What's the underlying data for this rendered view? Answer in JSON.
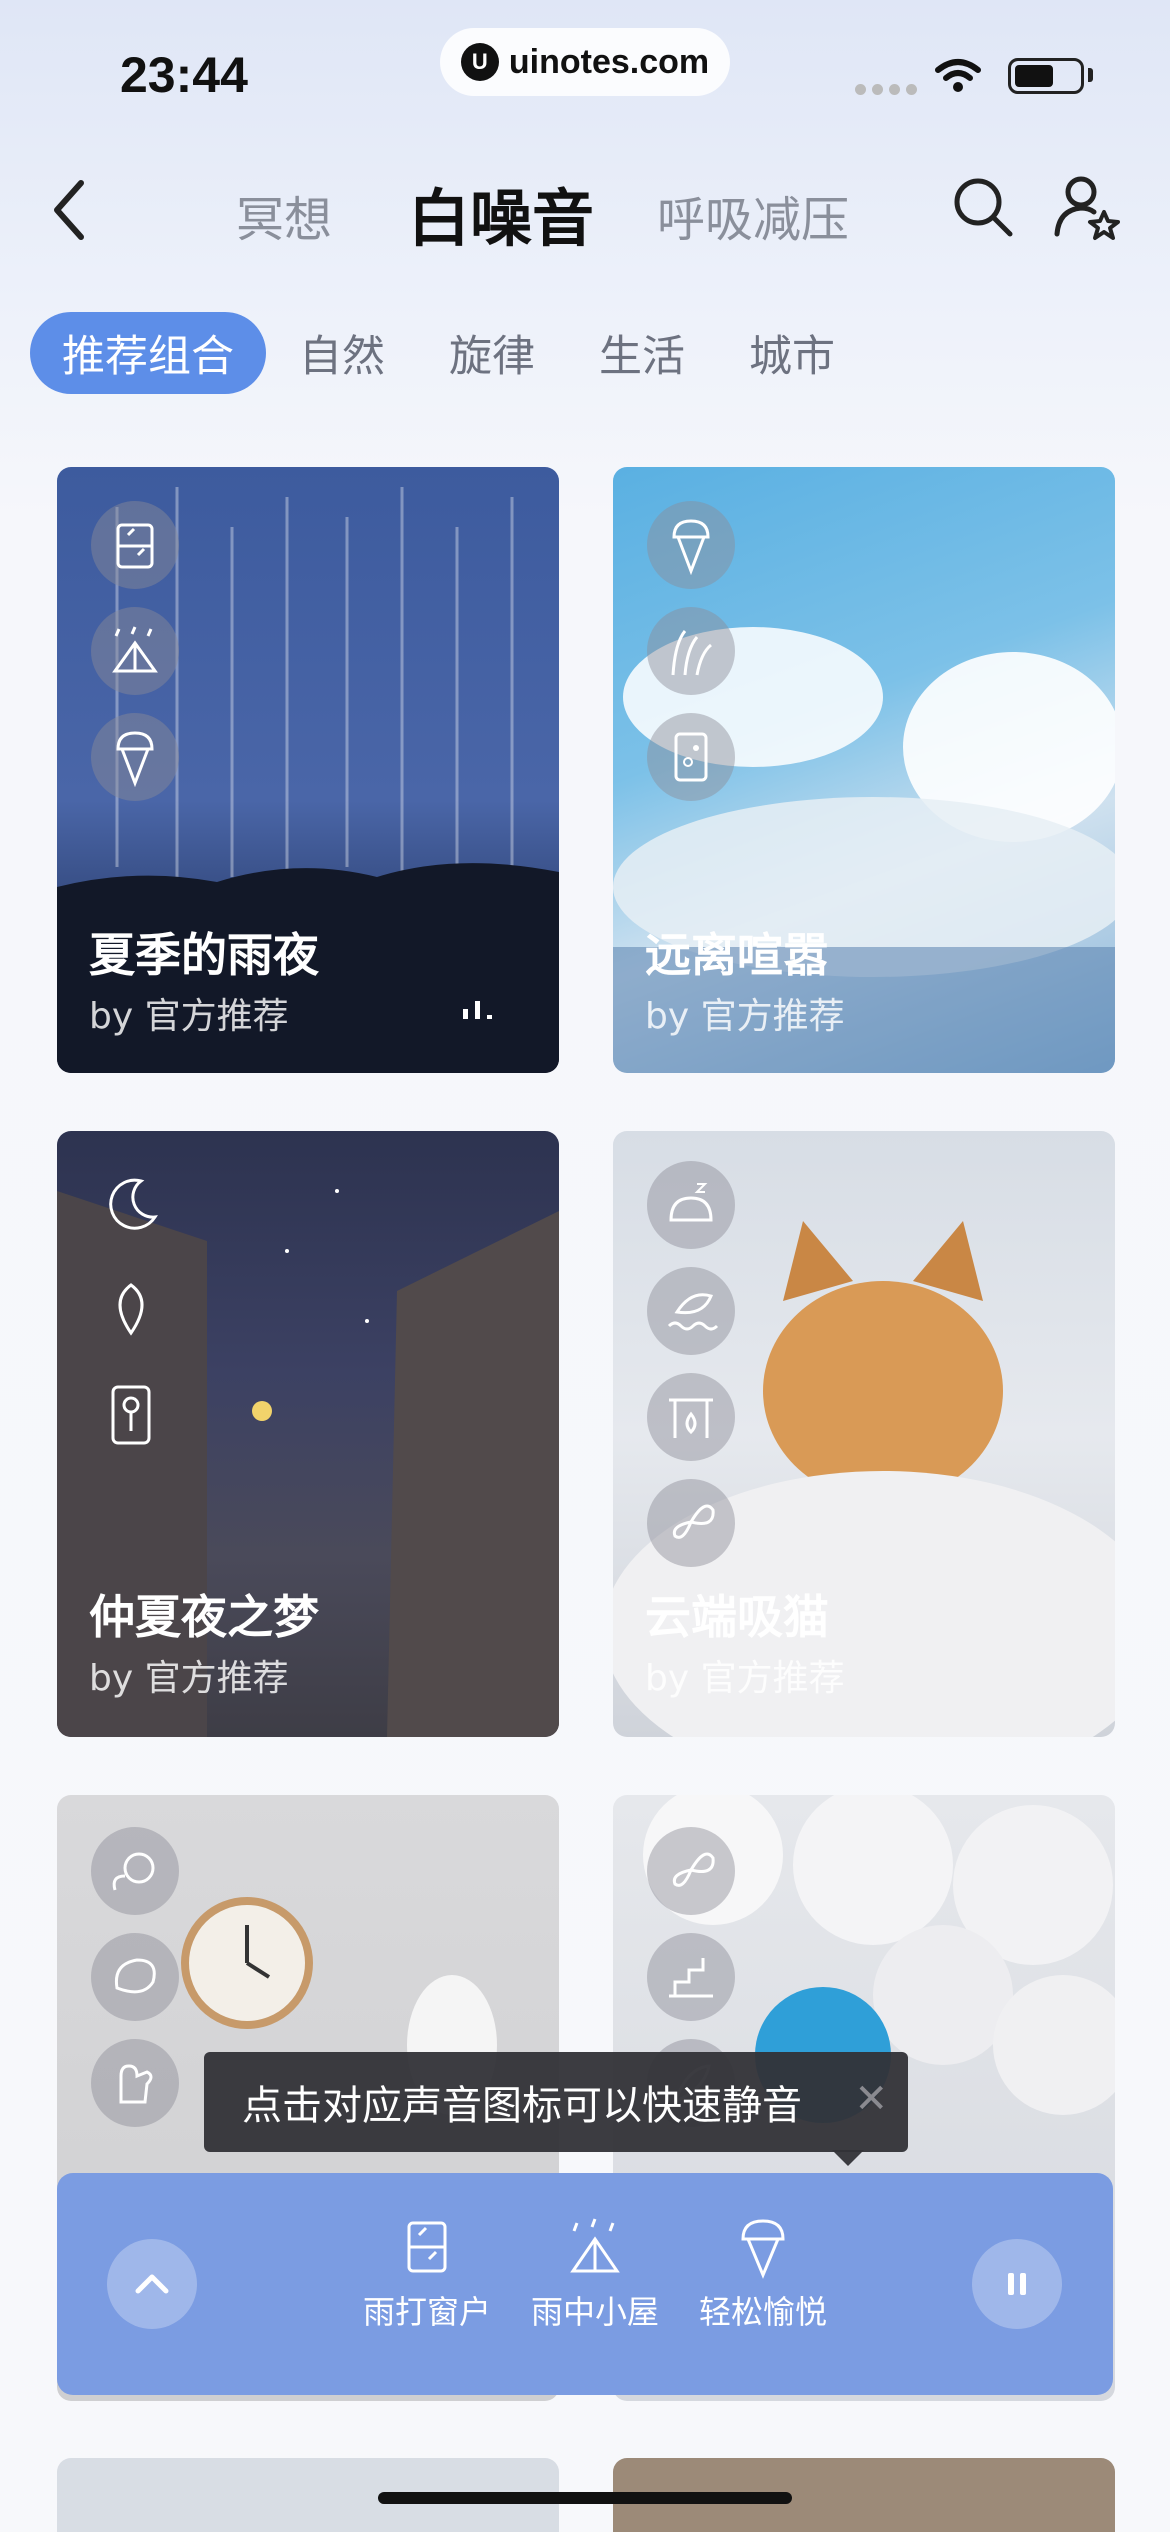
{
  "status": {
    "time": "23:44",
    "url": "uinotes.com",
    "url_logo": "U"
  },
  "header": {
    "tabs": [
      {
        "label": "冥想",
        "active": false
      },
      {
        "label": "白噪音",
        "active": true
      },
      {
        "label": "呼吸减压",
        "active": false
      }
    ],
    "icons": [
      "back-icon",
      "search-icon",
      "user-favorite-icon"
    ]
  },
  "categories": [
    {
      "label": "推荐组合",
      "active": true
    },
    {
      "label": "自然",
      "active": false
    },
    {
      "label": "旋律",
      "active": false
    },
    {
      "label": "生活",
      "active": false
    },
    {
      "label": "城市",
      "active": false
    }
  ],
  "cards": [
    {
      "title": "夏季的雨夜",
      "by": "by 官方推荐",
      "icons": [
        "window-rain-icon",
        "rain-tent-icon",
        "ice-cream-icon"
      ],
      "playing": true
    },
    {
      "title": "远离喧嚣",
      "by": "by 官方推荐",
      "icons": [
        "ice-cream-icon",
        "grass-icon",
        "scroll-icon"
      ]
    },
    {
      "title": "仲夏夜之梦",
      "by": "by 官方推荐",
      "icons": [
        "moon-icon",
        "leaf-moon-icon",
        "clock-pendulum-icon"
      ]
    },
    {
      "title": "云端吸猫",
      "by": "by 官方推荐",
      "icons": [
        "sleeping-cat-icon",
        "wave-leaf-icon",
        "fireplace-icon",
        "butterfly-icon"
      ]
    },
    {
      "title": "",
      "by": "",
      "icons": [
        "dish-icon",
        "bread-icon",
        "glove-icon"
      ]
    },
    {
      "title": "",
      "by": "",
      "icons": [
        "butterfly-icon",
        "stairs-icon",
        "feather-icon"
      ]
    }
  ],
  "toast": {
    "text": "点击对应声音图标可以快速静音",
    "close": "✕"
  },
  "player": {
    "items": [
      {
        "label": "雨打窗户",
        "icon": "window-rain-icon"
      },
      {
        "label": "雨中小屋",
        "icon": "rain-tent-icon"
      },
      {
        "label": "轻松愉悦",
        "icon": "ice-cream-icon"
      }
    ],
    "state": "playing"
  },
  "colors": {
    "accent": "#5d8ee8",
    "player_bg": "#7b9ce2"
  }
}
